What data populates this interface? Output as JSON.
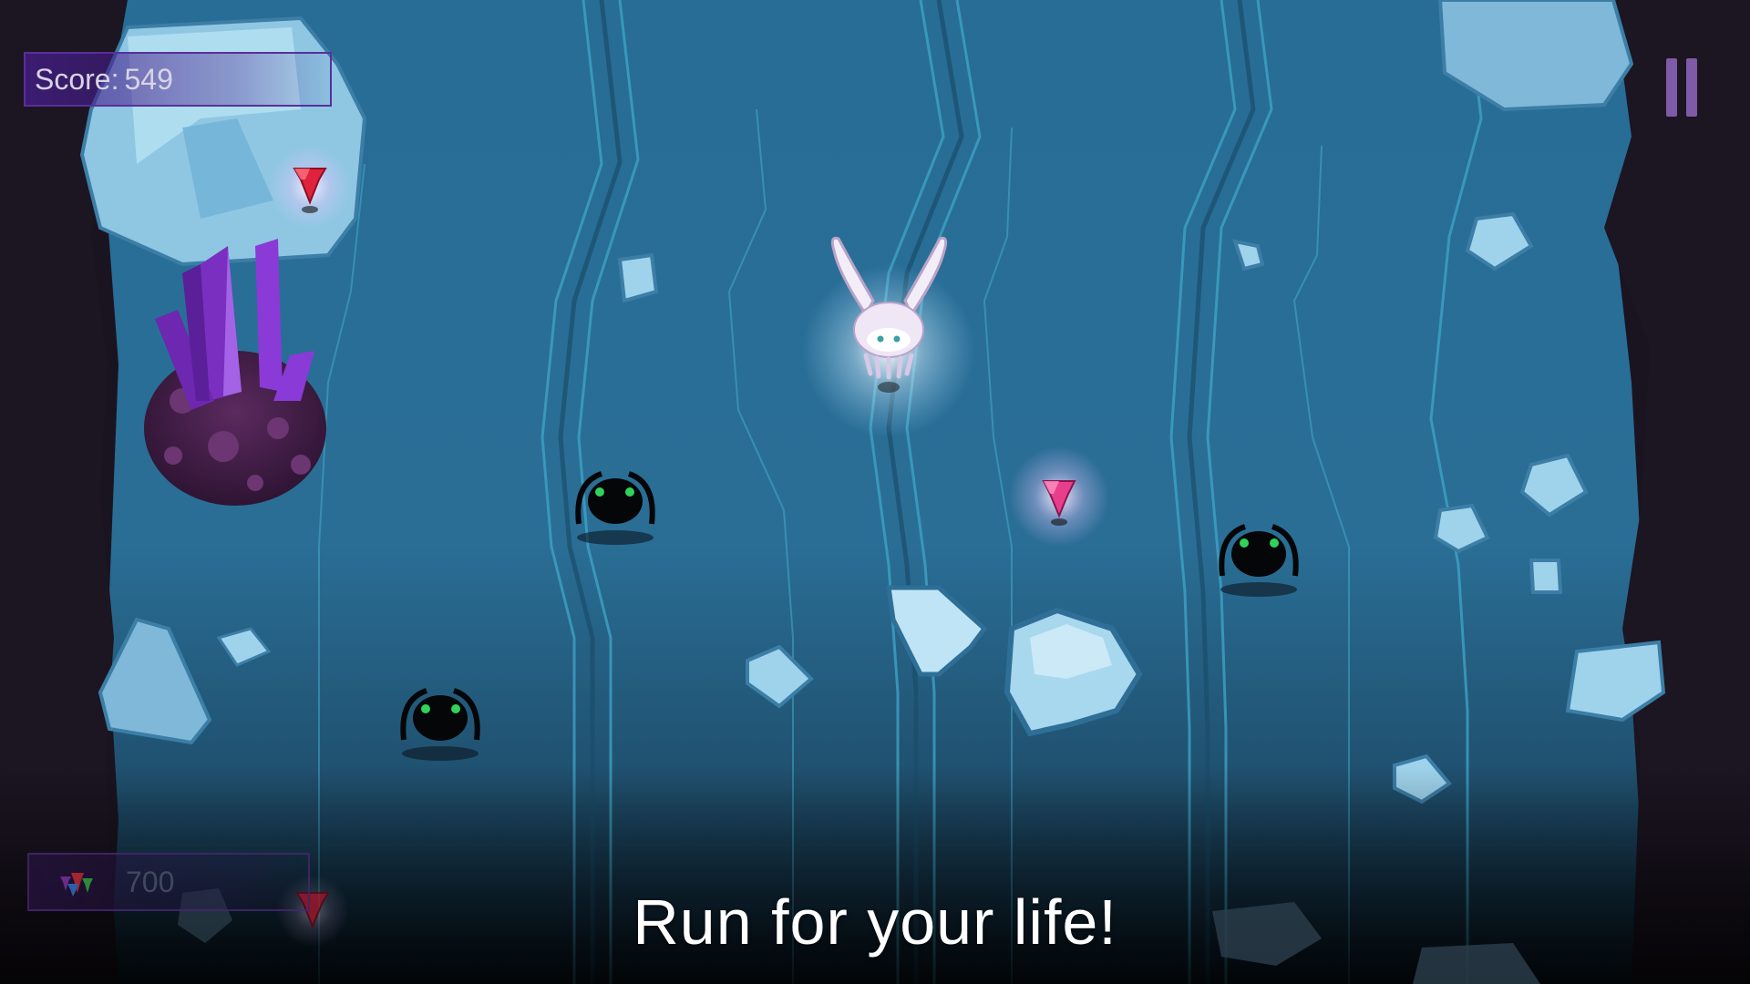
{
  "hud": {
    "score_label": "Score:",
    "score_value": "549",
    "gem_count": "700"
  },
  "message": "Run for your life!",
  "icons": {
    "pause": "pause-icon",
    "gem_bundle": "gem-bundle-icon"
  },
  "colors": {
    "background": "#2b6e95",
    "cave_wall": "#1c1522",
    "hud_border": "#5a2f9c",
    "pause": "#7f5aa6",
    "gem_red": "#e0233c",
    "gem_pink": "#e83e8c",
    "crystal": "#7a2fc0",
    "ice": "#9fd3ec",
    "enemy_eyes": "#2fd35a"
  }
}
